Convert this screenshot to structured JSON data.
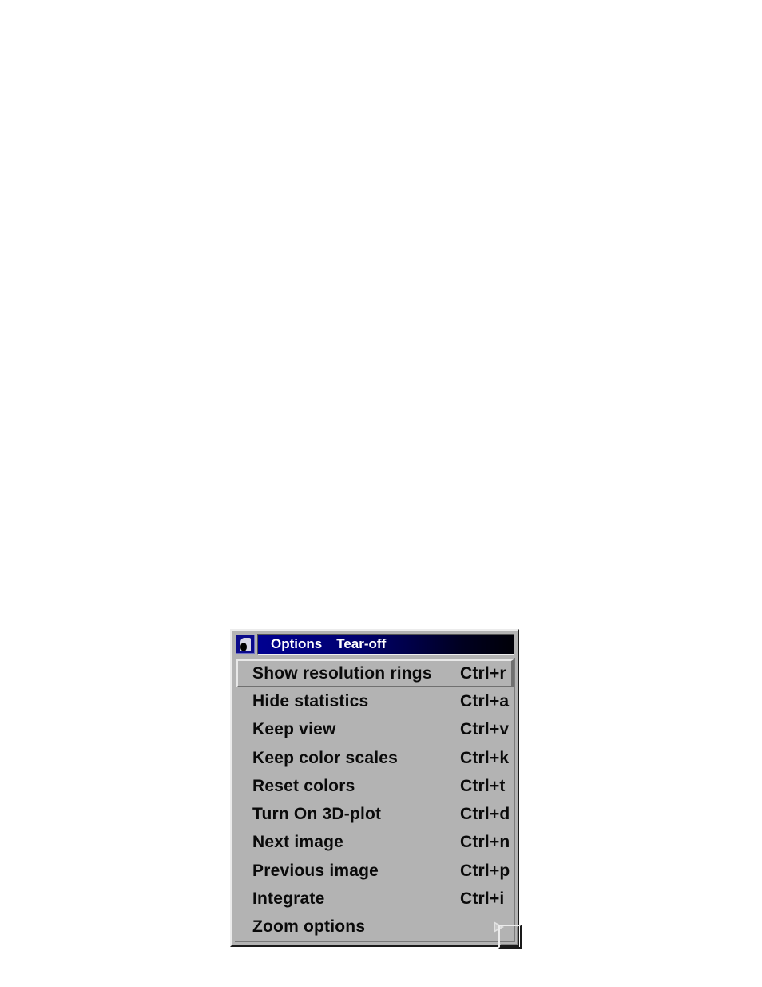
{
  "window": {
    "title_items": [
      "Options",
      "Tear-off"
    ],
    "app_icon": "application-icon"
  },
  "menu": {
    "items": [
      {
        "label": "Show resolution rings",
        "shortcut": "Ctrl+r",
        "active": true
      },
      {
        "label": "Hide statistics",
        "shortcut": "Ctrl+a"
      },
      {
        "label": "Keep view",
        "shortcut": "Ctrl+v"
      },
      {
        "label": "Keep color scales",
        "shortcut": "Ctrl+k"
      },
      {
        "label": "Reset colors",
        "shortcut": "Ctrl+t"
      },
      {
        "label": "Turn On 3D-plot",
        "shortcut": "Ctrl+d"
      },
      {
        "label": "Next image",
        "shortcut": "Ctrl+n"
      },
      {
        "label": "Previous image",
        "shortcut": "Ctrl+p"
      },
      {
        "label": "Integrate",
        "shortcut": "Ctrl+i"
      },
      {
        "label": "Zoom options",
        "shortcut": "",
        "submenu": true,
        "submenu_icon": "chevron-right-icon"
      }
    ]
  },
  "colors": {
    "menu_background": "#b3b3b3",
    "titlebar_start": "#000090",
    "titlebar_end": "#000008",
    "titlebar_text": "#ffffff",
    "menu_text": "#0a0a0a"
  }
}
